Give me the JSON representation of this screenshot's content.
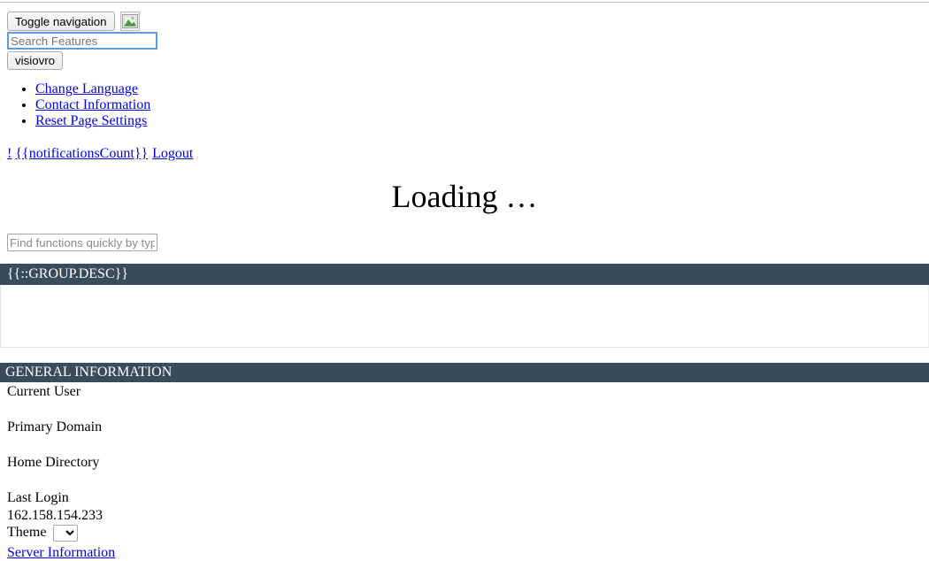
{
  "page": {
    "loading_text": "Loading …"
  },
  "navbar": {
    "toggle_label": "Toggle navigation",
    "brand_icon": "broken-image-icon",
    "search": {
      "placeholder": "Search Features",
      "value": ""
    },
    "user_button_label": "visiovro",
    "links": [
      {
        "label": "Change Language"
      },
      {
        "label": "Contact Information"
      },
      {
        "label": "Reset Page Settings"
      }
    ],
    "notifications": {
      "bang": "!",
      "count_expression": "{{notificationsCount}}",
      "logout_label": "Logout"
    }
  },
  "quickfind": {
    "placeholder": "Find functions quickly by typing here"
  },
  "group_panel": {
    "title": "{{::GROUP.DESC}}"
  },
  "general_information": {
    "title": "GENERAL INFORMATION",
    "rows": [
      {
        "label": "Current User",
        "value": ""
      },
      {
        "label": "Primary Domain",
        "value": ""
      },
      {
        "label": "Home Directory",
        "value": ""
      },
      {
        "label": "Last Login",
        "value": "162.158.154.233"
      }
    ],
    "theme": {
      "label": "Theme",
      "selected": "",
      "options": [
        ""
      ]
    },
    "server_information_label": "Server Information"
  },
  "colors": {
    "panel_header": "#3a4b5a",
    "link": "#0000ee",
    "focus_border": "#5b9dd9",
    "panel_border": "#e3e7ea"
  }
}
